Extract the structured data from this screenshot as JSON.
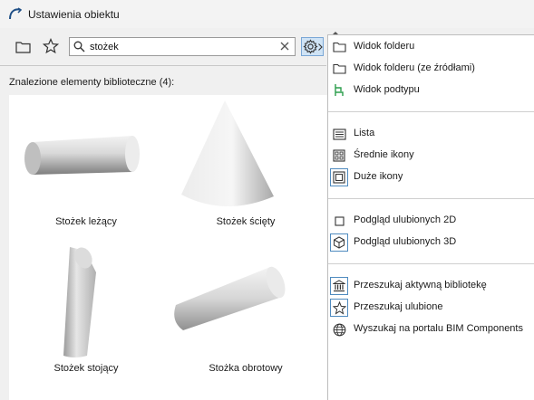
{
  "window": {
    "title": "Ustawienia obiektu"
  },
  "search": {
    "value": "stożek"
  },
  "results": {
    "heading": "Znalezione elementy biblioteczne (4):",
    "items": [
      {
        "label": "Stożek leżący"
      },
      {
        "label": "Stożek ścięty"
      },
      {
        "label": "Stożek stojący"
      },
      {
        "label": "Stożka obrotowy"
      }
    ]
  },
  "menu": {
    "items": [
      {
        "label": "Widok folderu",
        "icon": "folder-icon"
      },
      {
        "label": "Widok folderu (ze źródłami)",
        "icon": "folder-icon"
      },
      {
        "label": "Widok podtypu",
        "icon": "subtype-icon"
      },
      {
        "label": "Lista",
        "icon": "list-icon"
      },
      {
        "label": "Średnie ikony",
        "icon": "medium-icons-icon"
      },
      {
        "label": "Duże ikony",
        "icon": "large-icons-icon"
      },
      {
        "label": "Podgląd ulubionych 2D",
        "icon": "preview-2d-icon"
      },
      {
        "label": "Podgląd ulubionych 3D",
        "icon": "preview-3d-icon"
      },
      {
        "label": "Przeszukaj aktywną bibliotekę",
        "icon": "library-icon"
      },
      {
        "label": "Przeszukaj ulubione",
        "icon": "star-icon"
      },
      {
        "label": "Wyszukaj na portalu BIM Components",
        "icon": "globe-icon"
      }
    ]
  },
  "colors": {
    "accent": "#4f8bbf",
    "subtype": "#2a9d4b",
    "selected_bg": "#cfe3f5"
  }
}
